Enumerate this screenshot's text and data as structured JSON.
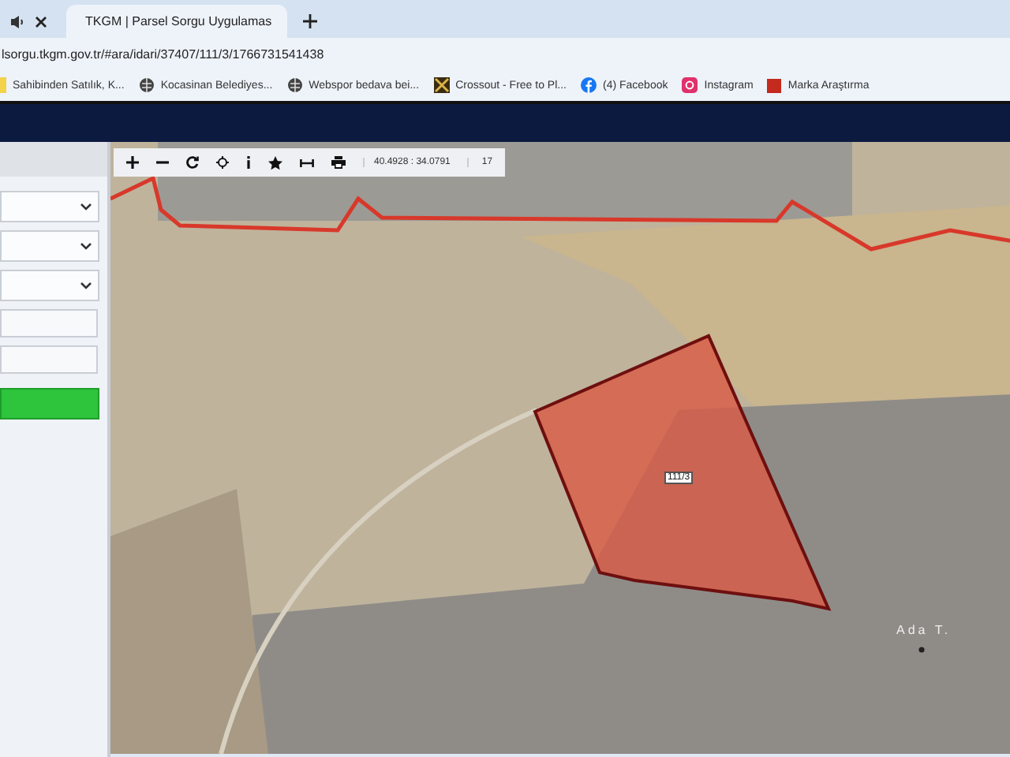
{
  "tabs": [
    {
      "selected": false,
      "audio": true
    },
    {
      "title": "TKGM | Parsel Sorgu Uygulamas",
      "selected": true,
      "audio": false
    }
  ],
  "address_bar": {
    "url": "lsorgu.tkgm.gov.tr/#ara/idari/37407/111/3/1766731541438"
  },
  "bookmarks": [
    {
      "kind": "folder",
      "label": "Sahibinden Satılık, K..."
    },
    {
      "kind": "globe",
      "label": "Kocasinan Belediyes..."
    },
    {
      "kind": "globe",
      "label": "Webspor bedava bei..."
    },
    {
      "kind": "crossout",
      "label": "Crossout - Free to Pl..."
    },
    {
      "kind": "facebook",
      "label": "(4) Facebook"
    },
    {
      "kind": "instagram",
      "label": "Instagram"
    },
    {
      "kind": "marka",
      "label": "Marka Araştırma"
    }
  ],
  "sidebar": {
    "fields": [
      {
        "kind": "select"
      },
      {
        "kind": "select"
      },
      {
        "kind": "select"
      },
      {
        "kind": "input"
      },
      {
        "kind": "input"
      }
    ]
  },
  "map": {
    "coordinates": "40.4928 : 34.0791",
    "zoom": "17",
    "parcel_label": "111/3",
    "place_label": "Ada T."
  }
}
